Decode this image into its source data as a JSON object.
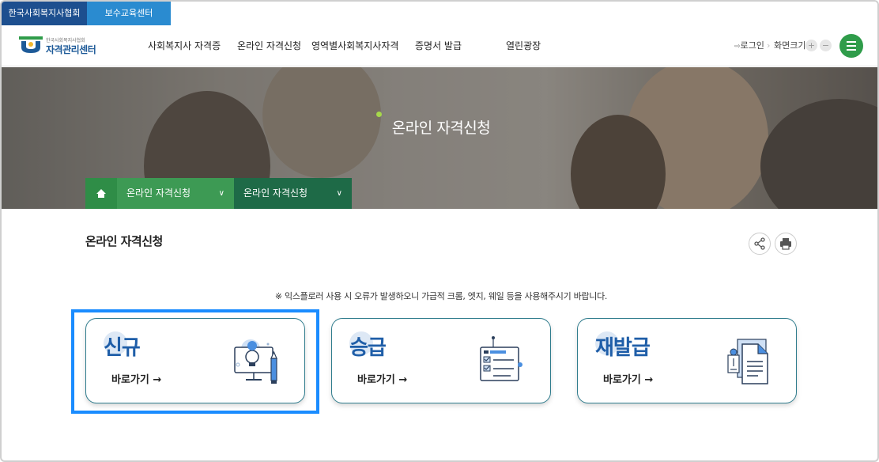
{
  "top_tabs": [
    "한국사회복지사협회",
    "보수교육센터"
  ],
  "logo": {
    "small_text": "한국사회복지사협회",
    "main_text": "자격관리센터"
  },
  "gnb": [
    "사회복지사 자격증",
    "온라인 자격신청",
    "영역별사회복지사자격",
    "증명서 발급",
    "열린광장"
  ],
  "util": {
    "login": "로그인",
    "zoom_label": "화면크기",
    "zoom_in": "+",
    "zoom_out": "−"
  },
  "hero": {
    "title": "온라인 자격신청"
  },
  "breadcrumb": [
    "온라인 자격신청",
    "온라인 자격신청"
  ],
  "page_title": "온라인 자격신청",
  "notice": "※ 익스플로러 사용 시 오류가 발생하오니 가급적 크롬, 엣지, 웨일 등을 사용해주시기 바랍니다.",
  "cards": [
    {
      "title": "신규",
      "link": "바로가기 →",
      "icon": "lightbulb-monitor-icon"
    },
    {
      "title": "승급",
      "link": "바로가기 →",
      "icon": "checklist-board-icon"
    },
    {
      "title": "재발급",
      "link": "바로가기 →",
      "icon": "document-reissue-icon"
    }
  ],
  "colors": {
    "accent_green": "#2f9c4a",
    "card_blue": "#1f5ea8",
    "highlight": "#1a8cff"
  }
}
